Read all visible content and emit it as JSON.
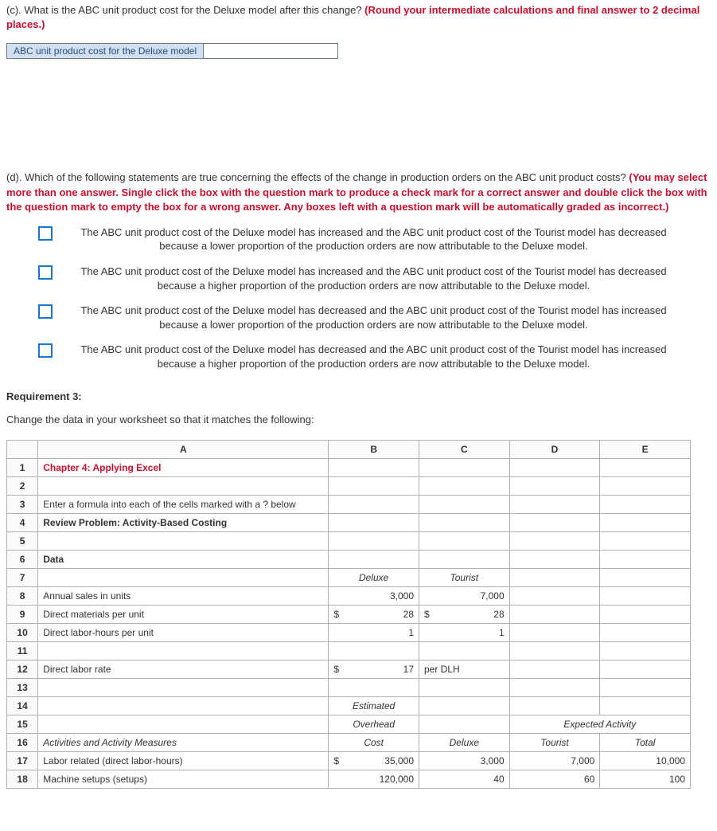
{
  "partC": {
    "prompt": "(c). What is the ABC unit product cost for the Deluxe model after this change? ",
    "redNote": "(Round your intermediate calculations and final answer to 2 decimal places.)",
    "inputLabel": "ABC unit product cost for the Deluxe model",
    "inputValue": ""
  },
  "partD": {
    "prompt": "(d). Which of the following statements are true concerning the effects of the change in production orders on the ABC unit product costs? ",
    "redNote": "(You may select more than one answer. Single click the box with the question mark to produce a check mark for a correct answer and double click the box with the question mark to empty the box for a wrong answer. Any boxes left with a question mark will be automatically graded as incorrect.)",
    "options": [
      "The ABC unit product cost of the Deluxe model has increased and the ABC unit product cost of the Tourist model has decreased because a lower proportion of the production orders are now attributable to the Deluxe model.",
      "The ABC unit product cost of the Deluxe model has increased and the ABC unit product cost of the Tourist model has decreased because a higher proportion of the production orders are now attributable to the Deluxe model.",
      "The ABC unit product cost of the Deluxe model has decreased and the ABC unit product cost of the Tourist model has increased because a lower proportion of the production orders are now attributable to the Deluxe model.",
      "The ABC unit product cost of the Deluxe model has decreased and the ABC unit product cost of the Tourist model has increased because a higher proportion of the production orders are now attributable to the Deluxe model."
    ]
  },
  "req3": {
    "title": "Requirement 3:",
    "instruction": "Change the data in your worksheet so that it matches the following:"
  },
  "table": {
    "headers": [
      "A",
      "B",
      "C",
      "D",
      "E"
    ],
    "rows": {
      "1": {
        "a": "Chapter 4: Applying Excel"
      },
      "3": {
        "a": "Enter a formula into each of the cells marked with a ? below"
      },
      "4": {
        "a": "Review Problem: Activity-Based Costing"
      },
      "6": {
        "a": "Data"
      },
      "7": {
        "b": "Deluxe",
        "c": "Tourist"
      },
      "8": {
        "a": "Annual sales in units",
        "b": "3,000",
        "c": "7,000"
      },
      "9": {
        "a": "Direct materials per unit",
        "b_sym": "$",
        "b_val": "28",
        "c_sym": "$",
        "c_val": "28"
      },
      "10": {
        "a": "Direct labor-hours per unit",
        "b": "1",
        "c": "1"
      },
      "12": {
        "a": "Direct labor rate",
        "b_sym": "$",
        "b_val": "17",
        "c": "per DLH"
      },
      "14": {
        "b": "Estimated"
      },
      "15": {
        "b": "Overhead",
        "d": "Expected Activity"
      },
      "16": {
        "a": "Activities and Activity Measures",
        "b": "Cost",
        "c": "Deluxe",
        "d": "Tourist",
        "e": "Total"
      },
      "17": {
        "a": "Labor related (direct labor-hours)",
        "b_sym": "$",
        "b_val": "35,000",
        "c": "3,000",
        "d": "7,000",
        "e": "10,000"
      },
      "18": {
        "a": "Machine setups (setups)",
        "b": "120,000",
        "c": "40",
        "d": "60",
        "e": "100"
      }
    }
  }
}
